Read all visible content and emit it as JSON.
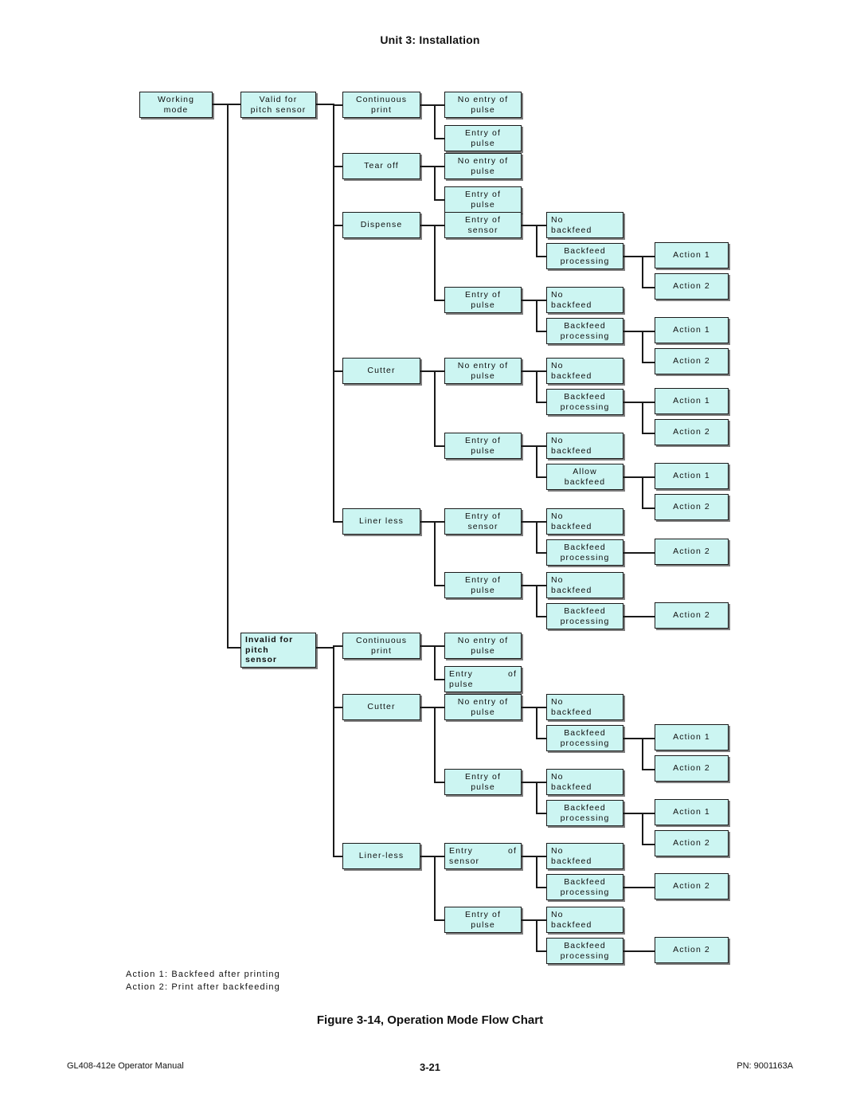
{
  "header": {
    "title": "Unit 3:  Installation"
  },
  "figure": {
    "caption": "Figure 3-14, Operation Mode Flow Chart"
  },
  "legend": {
    "line1": "Action 1: Backfeed after printing",
    "line2": "Action 2: Print after backfeeding"
  },
  "footer": {
    "left": "GL408-412e Operator Manual",
    "center": "3-21",
    "right": "PN: 9001163A"
  },
  "nodes": {
    "root": "Working\nmode",
    "valid": "Valid for\npitch sensor",
    "invalid": "Invalid for\npitch\nsensor",
    "v_continuous": "Continuous\nprint",
    "v_tearoff": "Tear off",
    "v_dispense": "Dispense",
    "v_cutter": "Cutter",
    "v_linerless": "Liner less",
    "i_continuous": "Continuous\nprint",
    "i_cutter": "Cutter",
    "i_linerless": "Liner-less",
    "noentry": "No entry of\npulse",
    "entrypulse": "Entry of\npulse",
    "entrysensor": "Entry of\nsensor",
    "nobackfeed": "No\nbackfeed",
    "backfeedproc": "Backfeed\nprocessing",
    "allowbackfeed": "Allow\nbackfeed",
    "action1": "Action 1",
    "action2": "Action 2"
  },
  "justified": {
    "entry": "Entry",
    "of": "of",
    "pulse": "pulse",
    "sensor": "sensor"
  },
  "colors": {
    "node_fill": "#ccf5f2",
    "node_border": "#1a1a1a",
    "line": "#1a1a1a",
    "text": "#101010"
  },
  "chart_data": {
    "type": "diagram",
    "title": "Figure 3-14, Operation Mode Flow Chart",
    "root": "Working mode",
    "branches": [
      {
        "label": "Valid for pitch sensor",
        "children": [
          {
            "label": "Continuous print",
            "children": [
              {
                "label": "No entry of pulse"
              },
              {
                "label": "Entry of pulse"
              }
            ]
          },
          {
            "label": "Tear off",
            "children": [
              {
                "label": "No entry of pulse"
              },
              {
                "label": "Entry of pulse"
              }
            ]
          },
          {
            "label": "Dispense",
            "children": [
              {
                "label": "Entry of sensor",
                "children": [
                  {
                    "label": "No backfeed"
                  },
                  {
                    "label": "Backfeed processing",
                    "children": [
                      {
                        "label": "Action 1"
                      },
                      {
                        "label": "Action 2"
                      }
                    ]
                  }
                ]
              },
              {
                "label": "Entry of pulse",
                "children": [
                  {
                    "label": "No backfeed"
                  },
                  {
                    "label": "Backfeed processing",
                    "children": [
                      {
                        "label": "Action 1"
                      },
                      {
                        "label": "Action 2"
                      }
                    ]
                  }
                ]
              }
            ]
          },
          {
            "label": "Cutter",
            "children": [
              {
                "label": "No entry of pulse",
                "children": [
                  {
                    "label": "No backfeed"
                  },
                  {
                    "label": "Backfeed processing",
                    "children": [
                      {
                        "label": "Action 1"
                      },
                      {
                        "label": "Action 2"
                      }
                    ]
                  }
                ]
              },
              {
                "label": "Entry of pulse",
                "children": [
                  {
                    "label": "No backfeed"
                  },
                  {
                    "label": "Allow backfeed",
                    "children": [
                      {
                        "label": "Action 1"
                      },
                      {
                        "label": "Action 2"
                      }
                    ]
                  }
                ]
              }
            ]
          },
          {
            "label": "Liner less",
            "children": [
              {
                "label": "Entry of sensor",
                "children": [
                  {
                    "label": "No backfeed"
                  },
                  {
                    "label": "Backfeed processing",
                    "children": [
                      {
                        "label": "Action 2"
                      }
                    ]
                  }
                ]
              },
              {
                "label": "Entry of pulse",
                "children": [
                  {
                    "label": "No backfeed"
                  },
                  {
                    "label": "Backfeed processing",
                    "children": [
                      {
                        "label": "Action 2"
                      }
                    ]
                  }
                ]
              }
            ]
          }
        ]
      },
      {
        "label": "Invalid for pitch sensor",
        "children": [
          {
            "label": "Continuous print",
            "children": [
              {
                "label": "No entry of pulse"
              },
              {
                "label": "Entry of pulse"
              }
            ]
          },
          {
            "label": "Cutter",
            "children": [
              {
                "label": "No entry of pulse",
                "children": [
                  {
                    "label": "No backfeed"
                  },
                  {
                    "label": "Backfeed processing",
                    "children": [
                      {
                        "label": "Action 1"
                      },
                      {
                        "label": "Action 2"
                      }
                    ]
                  }
                ]
              },
              {
                "label": "Entry of pulse",
                "children": [
                  {
                    "label": "No backfeed"
                  },
                  {
                    "label": "Backfeed processing",
                    "children": [
                      {
                        "label": "Action 1"
                      },
                      {
                        "label": "Action 2"
                      }
                    ]
                  }
                ]
              }
            ]
          },
          {
            "label": "Liner-less",
            "children": [
              {
                "label": "Entry of sensor",
                "children": [
                  {
                    "label": "No backfeed"
                  },
                  {
                    "label": "Backfeed processing",
                    "children": [
                      {
                        "label": "Action 2"
                      }
                    ]
                  }
                ]
              },
              {
                "label": "Entry of pulse",
                "children": [
                  {
                    "label": "No backfeed"
                  },
                  {
                    "label": "Backfeed processing",
                    "children": [
                      {
                        "label": "Action 2"
                      }
                    ]
                  }
                ]
              }
            ]
          }
        ]
      }
    ],
    "legend": [
      "Action 1: Backfeed after printing",
      "Action 2: Print after backfeeding"
    ]
  }
}
